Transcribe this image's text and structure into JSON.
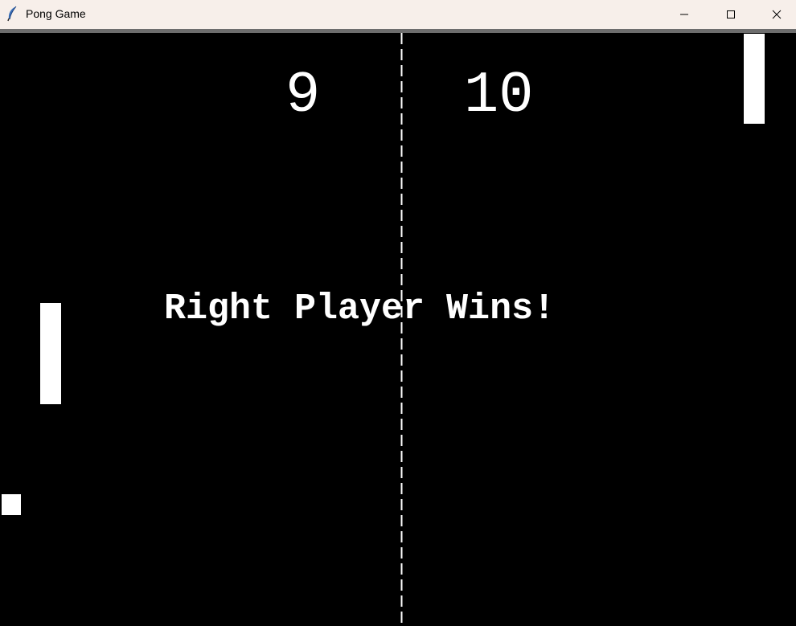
{
  "window": {
    "title": "Pong Game",
    "icon": "feather-icon",
    "controls": [
      "minimize-icon",
      "maximize-icon",
      "close-icon"
    ]
  },
  "game": {
    "score_left": "9",
    "score_right": "10",
    "message": "Right Player Wins!",
    "colors": {
      "background": "#000000",
      "foreground": "#ffffff",
      "titlebar": "#f7efea"
    }
  }
}
